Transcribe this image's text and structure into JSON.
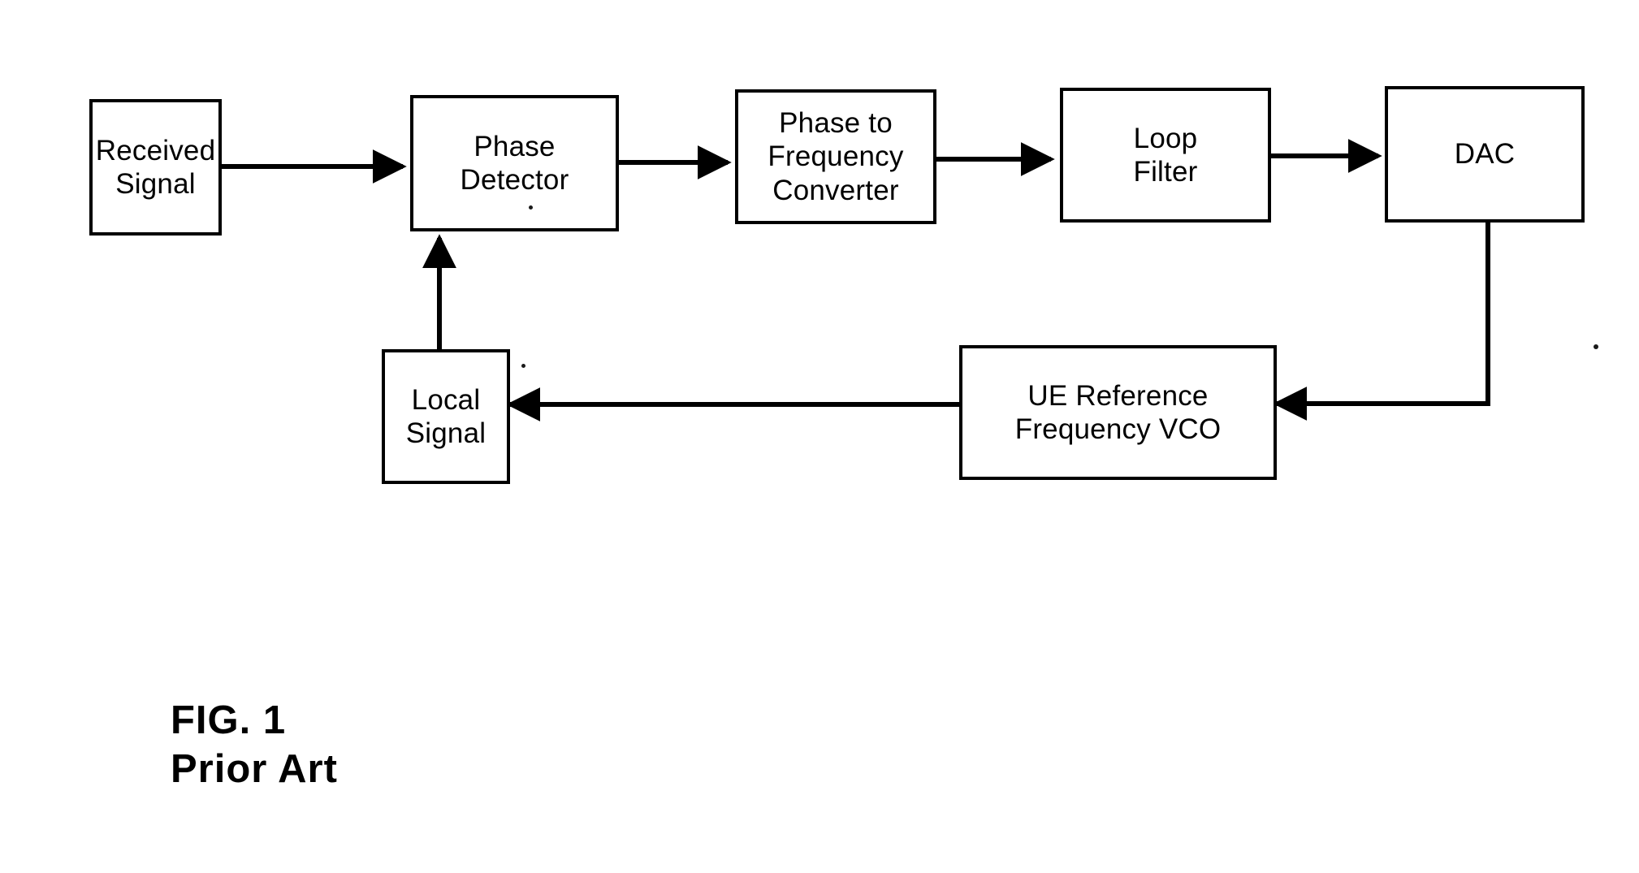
{
  "figure": {
    "caption_line_1": "FIG. 1",
    "caption_line_2": "Prior Art",
    "caption_text": "FIG. 1\nPrior Art",
    "type": "block-diagram",
    "subject": "Phase locked loop frequency tracking (prior art)",
    "ink_color": "#000000",
    "background_color": "#ffffff"
  },
  "blocks": {
    "received_signal": {
      "label": "Received\nSignal",
      "line_1": "Received",
      "line_2": "Signal"
    },
    "phase_detector": {
      "label": "Phase\nDetector",
      "line_1": "Phase",
      "line_2": "Detector"
    },
    "phase_to_frequency_converter": {
      "label": "Phase to\nFrequency\nConverter",
      "line_1": "Phase to",
      "line_2": "Frequency",
      "line_3": "Converter"
    },
    "loop_filter": {
      "label": "Loop\nFilter",
      "line_1": "Loop",
      "line_2": "Filter"
    },
    "dac": {
      "label": "DAC",
      "line_1": "DAC"
    },
    "local_signal": {
      "label": "Local\nSignal",
      "line_1": "Local",
      "line_2": "Signal"
    },
    "ue_reference_frequency_vco": {
      "label": "UE Reference\nFrequency VCO",
      "line_1": "UE Reference",
      "line_2": "Frequency VCO"
    }
  },
  "connections": [
    {
      "name": "received-signal-to-phase-detector",
      "from": "received_signal",
      "to": "phase_detector",
      "arrow": true
    },
    {
      "name": "phase-detector-to-phase-to-frequency-converter",
      "from": "phase_detector",
      "to": "phase_to_frequency_converter",
      "arrow": true
    },
    {
      "name": "phase-to-frequency-converter-to-loop-filter",
      "from": "phase_to_frequency_converter",
      "to": "loop_filter",
      "arrow": true
    },
    {
      "name": "loop-filter-to-dac",
      "from": "loop_filter",
      "to": "dac",
      "arrow": true
    },
    {
      "name": "dac-to-ue-reference-frequency-vco",
      "from": "dac",
      "to": "ue_reference_frequency_vco",
      "arrow": true
    },
    {
      "name": "ue-reference-frequency-vco-to-local-signal",
      "from": "ue_reference_frequency_vco",
      "to": "local_signal",
      "arrow": true
    },
    {
      "name": "local-signal-to-phase-detector",
      "from": "local_signal",
      "to": "phase_detector",
      "arrow": true
    }
  ]
}
